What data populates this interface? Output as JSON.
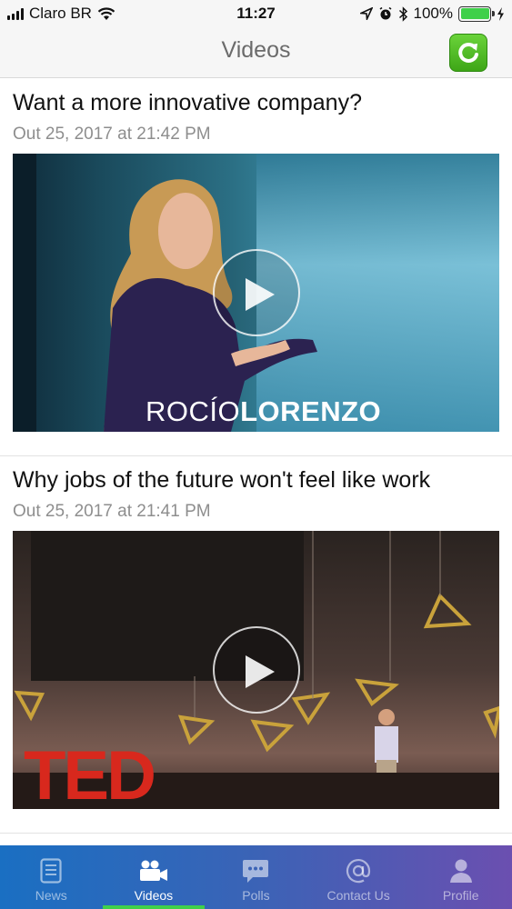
{
  "status_bar": {
    "carrier": "Claro BR",
    "time": "11:27",
    "battery_percent": "100%",
    "battery_level": 1.0
  },
  "nav": {
    "title": "Videos",
    "refresh_icon": "refresh-icon"
  },
  "videos": [
    {
      "title": "Want a more innovative company?",
      "date": "Out 25, 2017 at 21:42 PM",
      "overlay_text_light": "ROCÍO",
      "overlay_text_bold": "LORENZO"
    },
    {
      "title": "Why jobs of the future won't feel like work",
      "date": "Out 25, 2017 at 21:41 PM",
      "overlay_logo": "TED"
    }
  ],
  "tabs": [
    {
      "label": "News",
      "icon": "news-icon"
    },
    {
      "label": "Videos",
      "icon": "video-camera-icon",
      "active": true
    },
    {
      "label": "Polls",
      "icon": "chat-bubble-icon"
    },
    {
      "label": "Contact Us",
      "icon": "at-sign-icon"
    },
    {
      "label": "Profile",
      "icon": "person-icon"
    }
  ],
  "colors": {
    "accent_green": "#3fd04a",
    "tab_bar_start": "#1a6fc2",
    "tab_bar_end": "#6b4fb0"
  }
}
